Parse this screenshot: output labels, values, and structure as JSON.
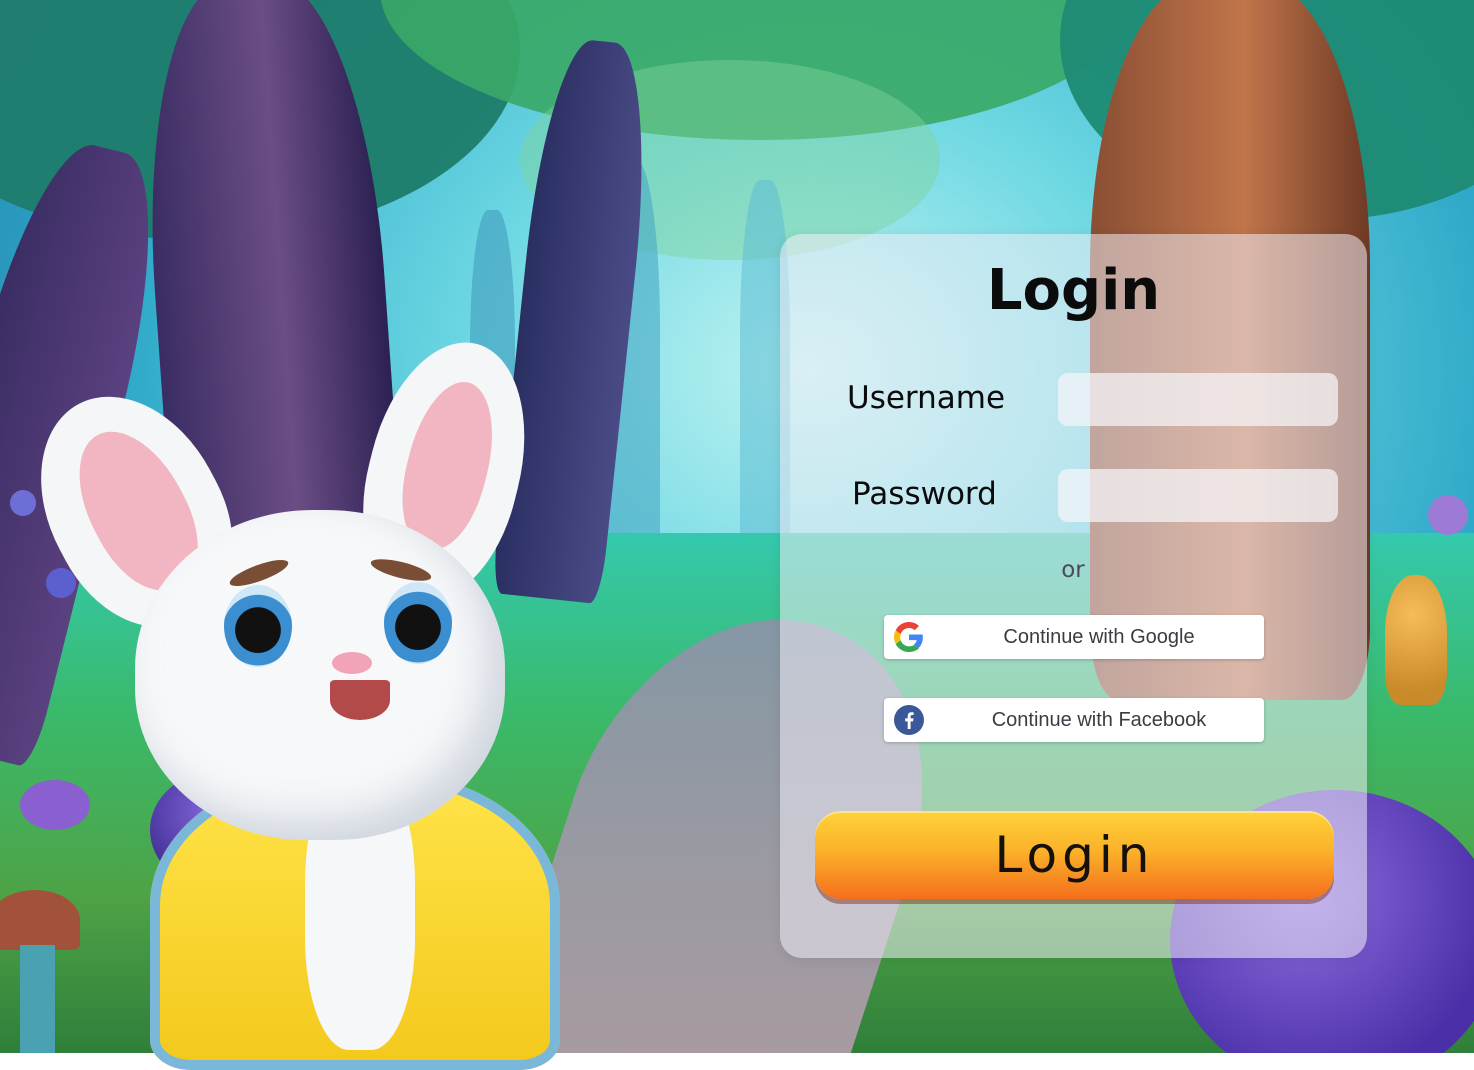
{
  "login_card": {
    "title": "Login",
    "username_label": "Username",
    "username_value": "",
    "password_label": "Password",
    "password_value": "",
    "divider_text": "or",
    "google_button_label": "Continue with Google",
    "facebook_button_label": "Continue with Facebook",
    "submit_label": "Login"
  },
  "icons": {
    "google": "google-icon",
    "facebook": "facebook-icon"
  },
  "colors": {
    "submit_gradient_top": "#ffd23a",
    "submit_gradient_bottom": "#f46f1c",
    "facebook_blue": "#3b5998",
    "card_tint": "#eeecf6"
  }
}
